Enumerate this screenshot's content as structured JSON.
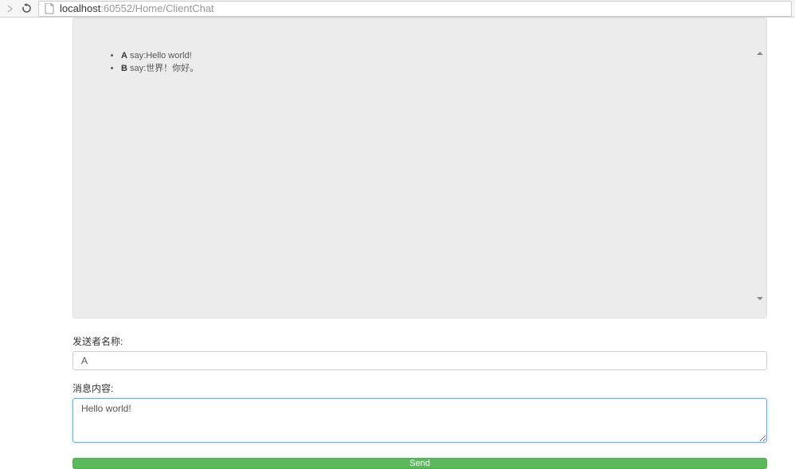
{
  "browser": {
    "url_host": "localhost",
    "url_rest": ":60552/Home/ClientChat"
  },
  "chat": {
    "messages": [
      {
        "sender": "A",
        "say_prefix": " say:",
        "text": "Hello world!"
      },
      {
        "sender": "B",
        "say_prefix": " say:",
        "text": "世界！你好。"
      }
    ]
  },
  "form": {
    "sender_label": "发送者名称:",
    "sender_value": "A",
    "message_label": "消息内容:",
    "message_value": "Hello world!",
    "send_label": "Send"
  }
}
